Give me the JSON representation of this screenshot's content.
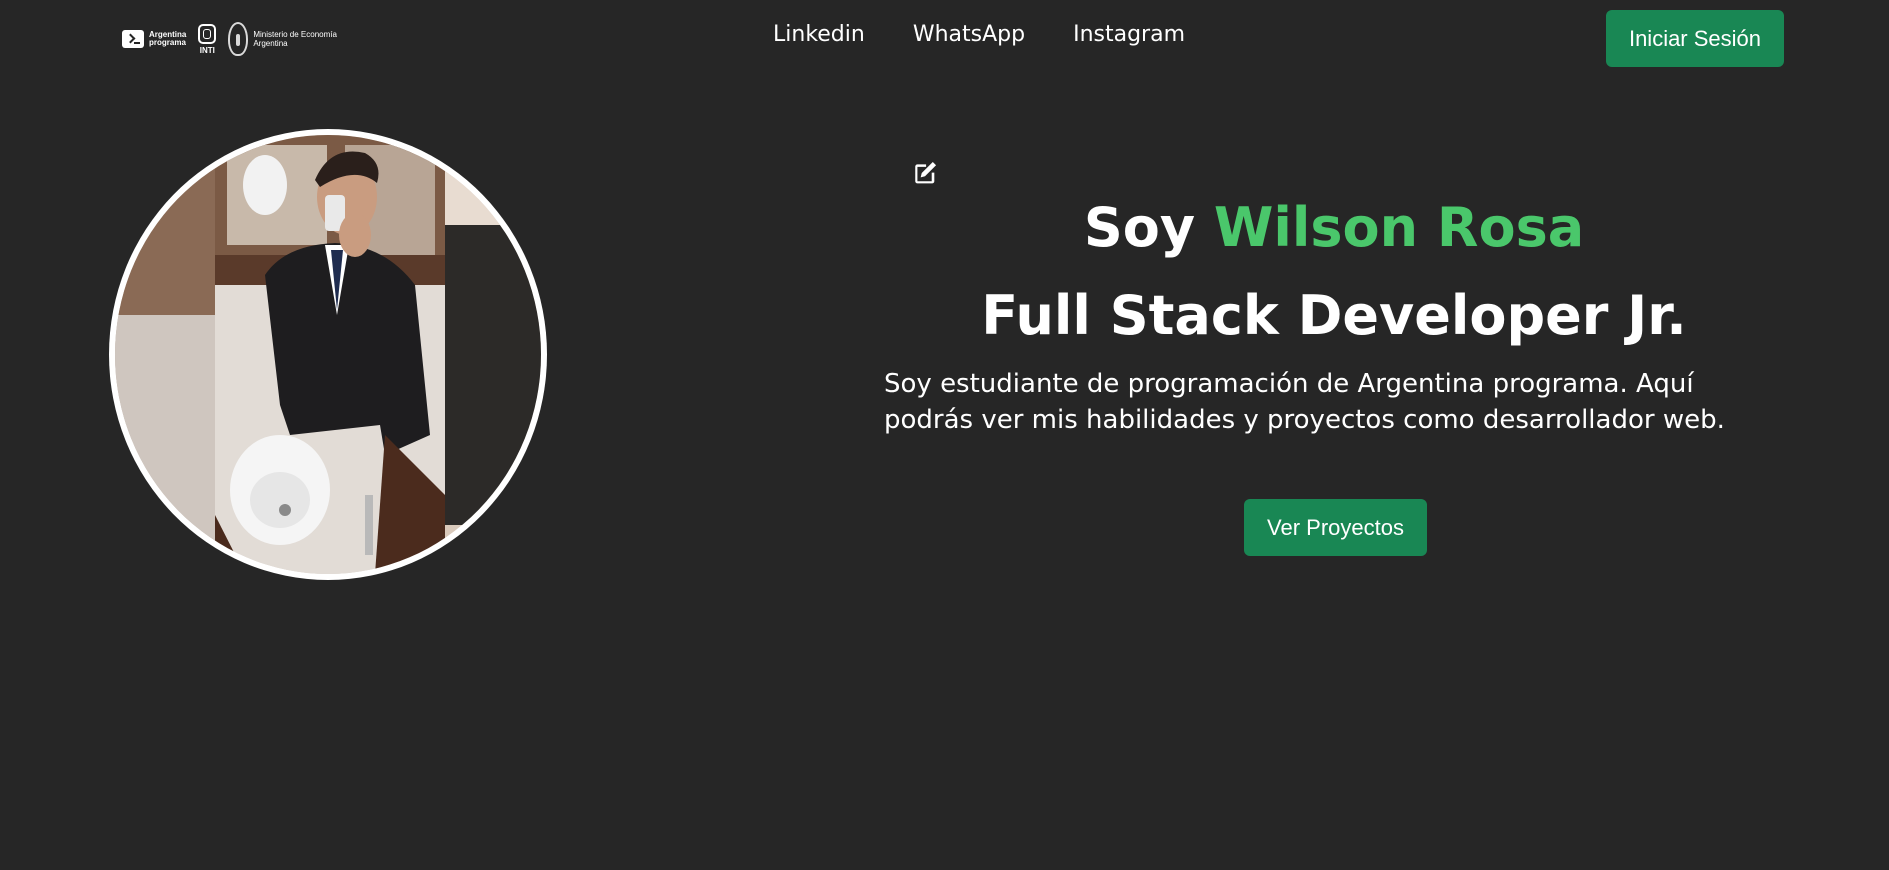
{
  "navbar": {
    "logos": {
      "argentina_programa": "Argentina\nprograma",
      "inti": "INTI",
      "ministerio": "Ministerio de Economía\nArgentina"
    },
    "links": [
      {
        "label": "Linkedin"
      },
      {
        "label": "WhatsApp"
      },
      {
        "label": "Instagram"
      }
    ],
    "login_label": "Iniciar Sesión"
  },
  "hero": {
    "title_prefix": "Soy ",
    "name": "Wilson Rosa",
    "subtitle": "Full Stack Developer Jr.",
    "description": "Soy estudiante de programación de Argentina programa. Aquí podrás ver mis habilidades y proyectos como desarrollador web.",
    "projects_button": "Ver Proyectos",
    "edit_icon": "edit-icon"
  },
  "colors": {
    "background": "#262626",
    "accent_green": "#4ac76b",
    "button_green": "#198754",
    "text": "#ffffff"
  }
}
